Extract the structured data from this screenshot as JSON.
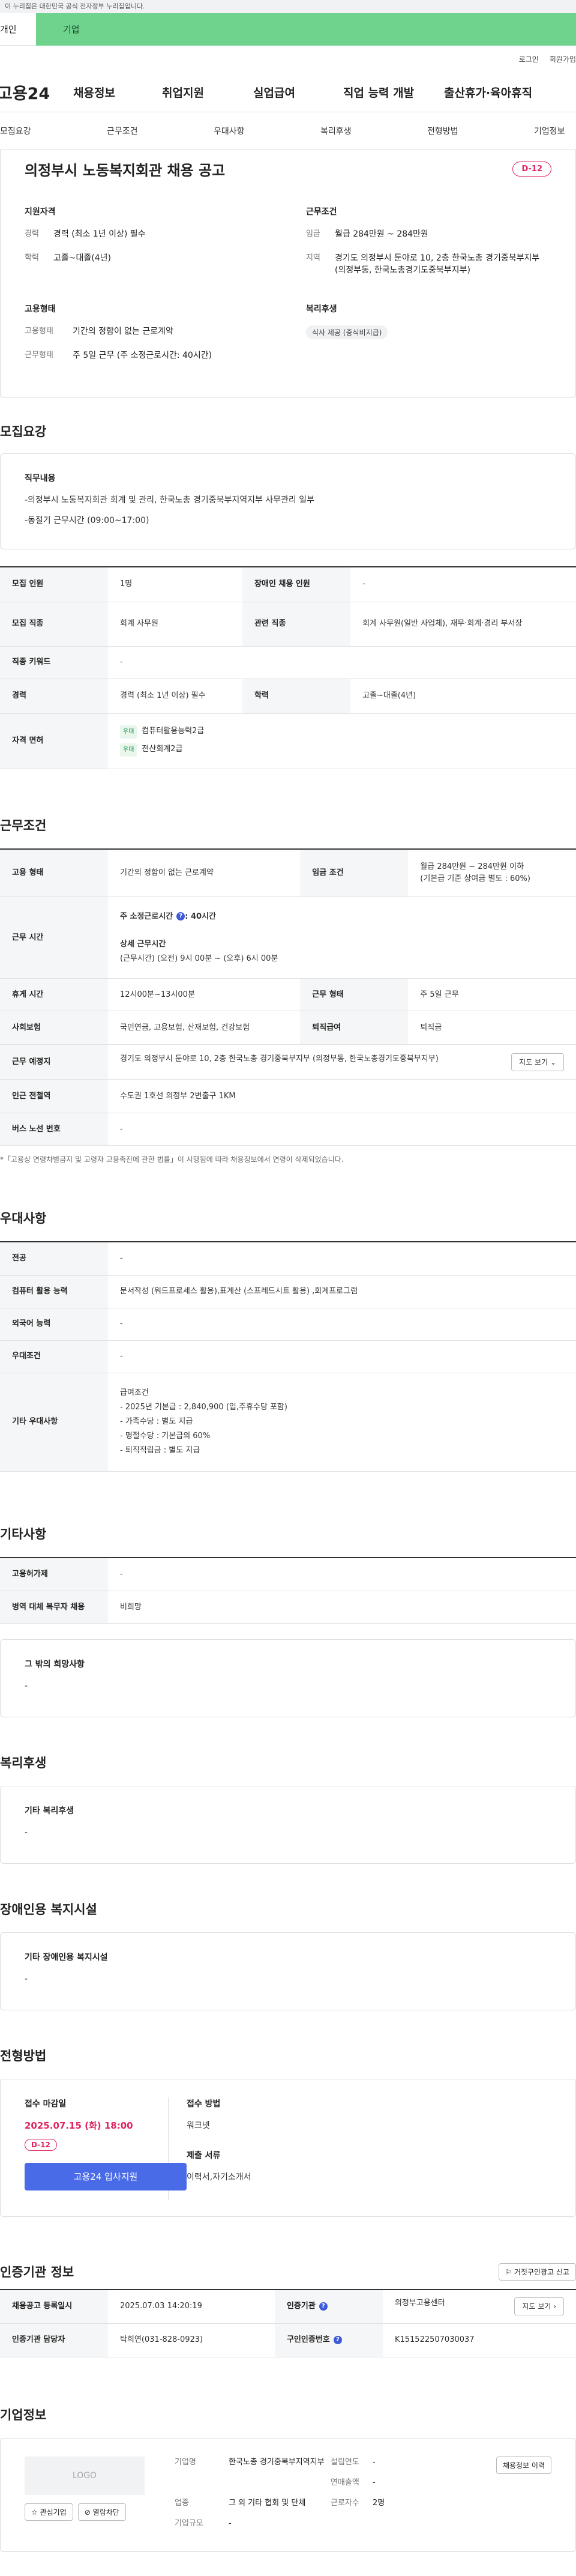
{
  "gov_bar": "이 누리집은 대한민국 공식 전자정부 누리집입니다.",
  "top_tabs": [
    "개인",
    "기업"
  ],
  "util": [
    "로그인",
    "회원가입"
  ],
  "logo": "고용24",
  "gnb": [
    "채용정보",
    "취업지원",
    "실업급여",
    "직업 능력 개발",
    "출산휴가·육아휴직"
  ],
  "snb": [
    "모집요강",
    "근무조건",
    "우대사항",
    "복리후생",
    "전형방법",
    "기업정보"
  ],
  "job": {
    "title": "의정부시 노동복지회관 채용 공고",
    "dday": "D-12",
    "qual_title": "지원자격",
    "cond_title": "근무조건",
    "career_k": "경력",
    "career_v": "경력 (최소 1년 이상) 필수",
    "edu_k": "학력",
    "edu_v": "고졸~대졸(4년)",
    "wage_k": "임금",
    "wage_v": "월급 284만원 ~ 284만원",
    "area_k": "지역",
    "area_v": "경기도 의정부시 둔야로 10, 2층 한국노총 경기중북부지부 (의정부동, 한국노총경기도중북부지부)",
    "emp_title": "고용형태",
    "emp_k": "고용형태",
    "emp_v": "기간의 정함이 없는 근로계약",
    "hours_k": "근무형태",
    "hours_v": "주 5일 근무 (주 소정근로시간: 40시간)",
    "welfare_title": "복리후생",
    "welfare_chip": "식사 제공 (중식비지급)"
  },
  "recruit": {
    "heading": "모집요강",
    "duty_title": "직무내용",
    "duty_line1": "-의정부시 노동복지회관 회계 및 관리, 한국노총 경기중북부지역지부 사무관리 일부",
    "duty_line2": "-동절기 근무시간 (09:00~17:00)",
    "rows": {
      "count_k": "모집 인원",
      "count_v": "1명",
      "disabled_k": "장애인 채용 인원",
      "disabled_v": "-",
      "job_k": "모집 직종",
      "job_v": "회계 사무원",
      "rel_k": "관련 직종",
      "rel_v": "회계 사무원(일반 사업체), 재무·회계·경리 부서장",
      "kw_k": "직종 키워드",
      "kw_v": "-",
      "career_k": "경력",
      "career_v": "경력 (최소 1년 이상) 필수",
      "edu_k": "학력",
      "edu_v": "고졸~대졸(4년)",
      "lic_k": "자격 면허",
      "lic_tag": "우대",
      "lic1": "컴퓨터활용능력2급",
      "lic2": "전산회계2급"
    }
  },
  "work": {
    "heading": "근무조건",
    "emp_k": "고용 형태",
    "emp_v": "기간의 정함이 없는 근로계약",
    "wage_k": "임금 조건",
    "wage_v1": "월급 284만원 ~ 284만원 이하",
    "wage_v2": "(기본급 기준 상여금 별도 : 60%)",
    "time_k": "근무 시간",
    "time_main": "주 소정근로시간",
    "time_main_v": ": 40시간",
    "time_detail_t": "상세 근무시간",
    "time_detail_v": "(근무시간) (오전) 9시 00분 ~ (오후) 6시 00분",
    "rest_k": "휴게 시간",
    "rest_v": "12시00분~13시00분",
    "type_k": "근무 형태",
    "type_v": "주 5일 근무",
    "ins_k": "사회보험",
    "ins_v": "국민연금, 고용보험, 산재보험, 건강보험",
    "ret_k": "퇴직급여",
    "ret_v": "퇴직금",
    "place_k": "근무 예정지",
    "place_v": "경기도 의정부시 둔야로 10, 2층 한국노총 경기중북부지부 (의정부동, 한국노총경기도중북부지부)",
    "map_btn": "지도 보기",
    "sub_k": "인근 전철역",
    "sub_v": "수도권 1호선 의정부 2번출구 1KM",
    "bus_k": "버스 노선 번호",
    "bus_v": "-",
    "note": "*「고용상 연령차별금지 및 고령자 고용촉진에 관한 법률」이 시행됨에 따라 채용정보에서 연령이 삭제되었습니다."
  },
  "pref": {
    "heading": "우대사항",
    "major_k": "전공",
    "major_v": "-",
    "pc_k": "컴퓨터 활용 능력",
    "pc_v": "문서작성 (워드프로세스 활용),표계산 (스프레드시트 활용) ,회계프로그램",
    "lang_k": "외국어 능력",
    "lang_v": "-",
    "cond_k": "우대조건",
    "cond_v": "-",
    "etc_k": "기타 우대사항",
    "etc_lines": [
      "급여조건",
      "- 2025년 기본급 : 2,840,900 (입,주휴수당 포함)",
      "- 가족수당 : 별도 지급",
      "- 명절수당 : 기본급의 60%",
      "- 퇴직적립금 : 별도 지급"
    ]
  },
  "other": {
    "heading": "기타사항",
    "support_k": "고용허가제",
    "support_v": "-",
    "mil_k": "병역 대체 복무자 채용",
    "mil_v": "비희망",
    "wish_title": "그 밖의 희망사항",
    "wish_v": "-"
  },
  "benefit": {
    "heading": "복리후생",
    "title": "기타 복리후생",
    "v": "-"
  },
  "disabled": {
    "heading": "장애인용 복지시설",
    "title": "기타 장애인용 복지시설",
    "v": "-"
  },
  "process": {
    "heading": "전형방법",
    "deadline_t": "접수 마감일",
    "deadline_v": "2025.07.15 (화) 18:00",
    "dday": "D-12",
    "apply_btn": "고용24 입사지원",
    "method_t": "접수 방법",
    "method_v": "워크넷",
    "docs_t": "제출 서류",
    "docs_v": "이력서,자기소개서"
  },
  "cert": {
    "heading": "인증기관 정보",
    "report_btn": "거짓구인광고 신고",
    "reg_k": "채용공고 등록일시",
    "reg_v": "2025.07.03 14:20:19",
    "org_k": "인증기관",
    "org_v": "의정부고용센터",
    "map_btn": "지도 보기",
    "mgr_k": "인증기관 담당자",
    "mgr_v": "탁희연(031-828-0923)",
    "id_k": "구인인증번호",
    "id_v": "K151522507030037"
  },
  "company": {
    "heading": "기업정보",
    "logo": "LOGO",
    "fav_btn": "관심기업",
    "block_btn": "열람차단",
    "name_k": "기업명",
    "name_v": "한국노총 경기중북부지역지부",
    "found_k": "설립연도",
    "found_v": "-",
    "sales_k": "연매출액",
    "sales_v": "-",
    "ind_k": "업종",
    "ind_v": "그 외 기타 협회 및 단체",
    "emp_k": "근로자수",
    "emp_v": "2명",
    "size_k": "기업규모",
    "size_v": "-",
    "hist_btn": "채용정보 이력"
  }
}
